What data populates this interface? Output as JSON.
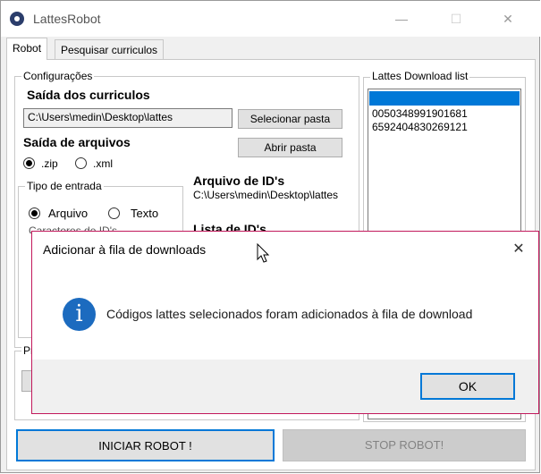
{
  "window": {
    "title": "LattesRobot",
    "minimize": "—",
    "maximize": "☐",
    "close": "✕"
  },
  "tabs": [
    {
      "label": "Robot"
    },
    {
      "label": "Pesquisar curriculos"
    }
  ],
  "config": {
    "legend": "Configurações",
    "saida_curriculos_label": "Saída dos curriculos",
    "saida_path": "C:\\Users\\medin\\Desktop\\lattes",
    "selecionar_pasta": "Selecionar pasta",
    "saida_arquivos_label": "Saída de arquivos",
    "opt_zip": ".zip",
    "opt_xml": ".xml",
    "abrir_pasta": "Abrir pasta",
    "tipo_entrada_legend": "Tipo de entrada",
    "opt_arquivo": "Arquivo",
    "opt_texto": "Texto",
    "arquivo_ids_label": "Arquivo de ID's",
    "arquivo_ids_path": "C:\\Users\\medin\\Desktop\\lattes",
    "lista_ids_label": "Lista de ID's",
    "partial_text": "Caracteres de ID's"
  },
  "download_list": {
    "legend": "Lattes Download list",
    "items": [
      "0050348991901681",
      "6592404830269121"
    ]
  },
  "progress_legend": "Pr",
  "buttons": {
    "iniciar": "INICIAR ROBOT !",
    "stop": "STOP ROBOT!"
  },
  "dialog": {
    "title": "Adicionar à fila de downloads",
    "close": "✕",
    "icon": "i",
    "message": "Códigos lattes selecionados foram adicionados à fila de download",
    "ok": "OK"
  }
}
